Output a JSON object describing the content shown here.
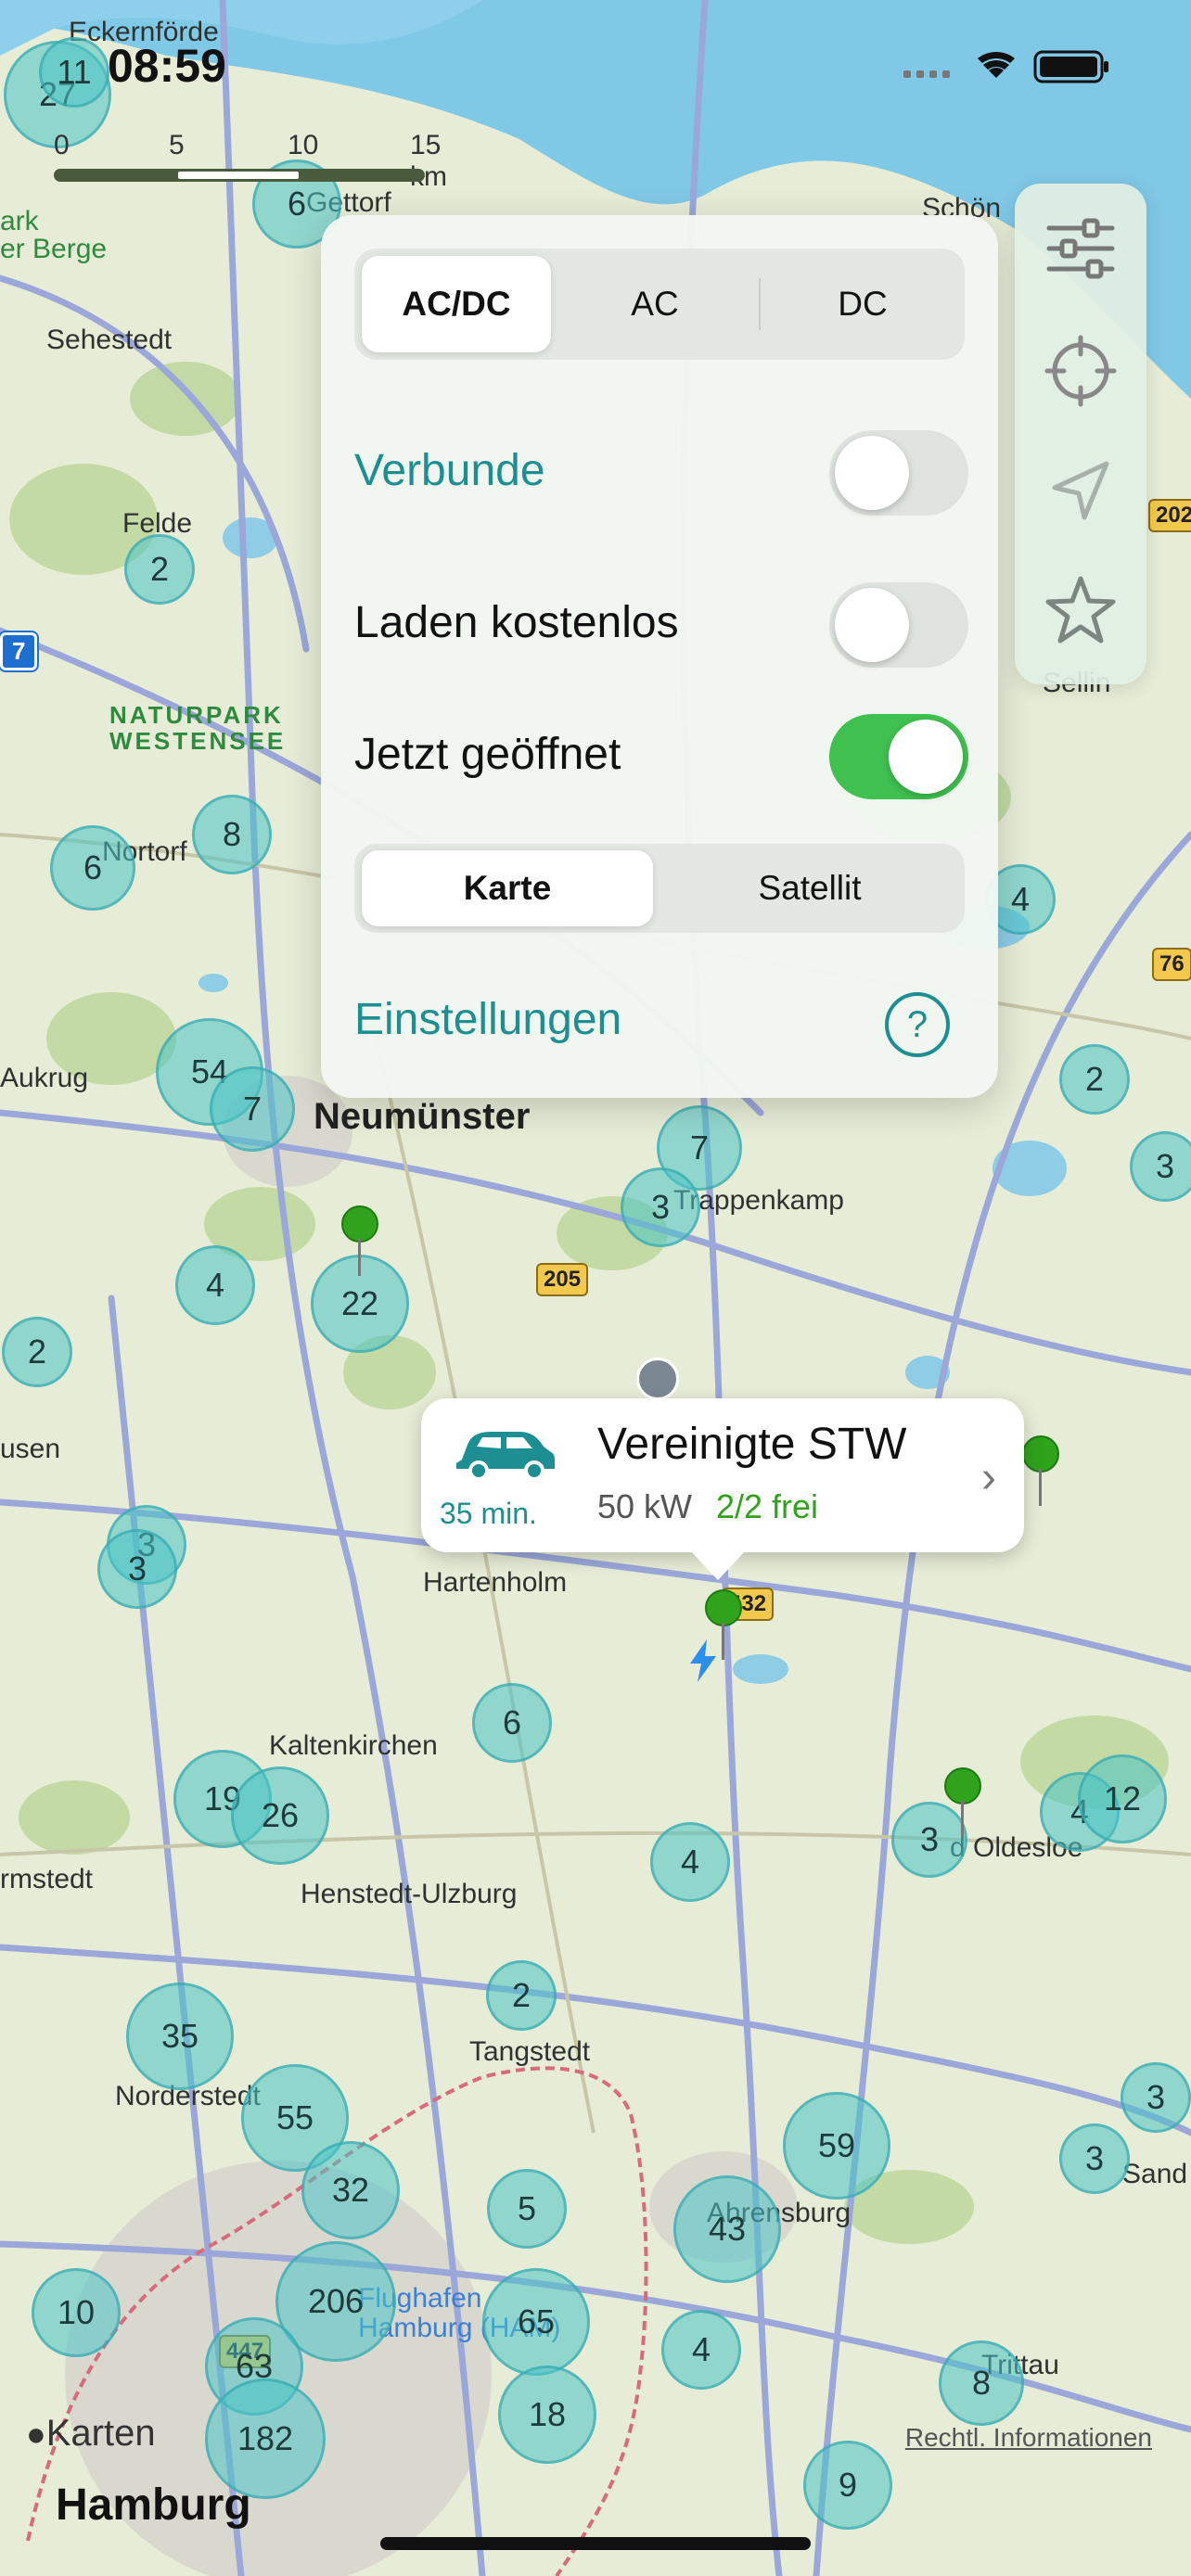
{
  "status": {
    "time": "08:59"
  },
  "scale": {
    "ticks": [
      "0",
      "5",
      "10",
      "15 km"
    ]
  },
  "panel": {
    "power_segment": {
      "options": [
        "AC/DC",
        "AC",
        "DC"
      ],
      "selected": "AC/DC"
    },
    "toggles": [
      {
        "label": "Verbunde",
        "on": false
      },
      {
        "label": "Laden kostenlos",
        "on": false
      },
      {
        "label": "Jetzt geöffnet",
        "on": true
      }
    ],
    "map_type": {
      "options": [
        "Karte",
        "Satellit"
      ],
      "selected": "Karte"
    },
    "settings_label": "Einstellungen",
    "help_icon": "?"
  },
  "toolbar": {
    "icons": [
      "filter-sliders-icon",
      "crosshair-icon",
      "location-arrow-icon",
      "star-icon"
    ]
  },
  "callout": {
    "title": "Vereinigte STW",
    "power": "50 kW",
    "availability": "2/2 frei",
    "eta": "35 min.",
    "icon": "car-icon"
  },
  "places": {
    "eckernfoerde": "Eckernförde",
    "gettorf": "Gettorf",
    "schoen": "Schön",
    "naturpark_ark": "ark",
    "huettener_berge": "er Berge",
    "sehestedt": "Sehestedt",
    "felde": "Felde",
    "naturpark": "NATURPARK",
    "westensee": "WESTENSEE",
    "nortorf": "Nortorf",
    "aukrug": "Aukrug",
    "neumuenster": "Neumünster",
    "trappenkamp": "Trappenkamp",
    "sellin": "Sellin",
    "hausen": "usen",
    "hartenholm": "Hartenholm",
    "kaltenkirchen": "Kaltenkirchen",
    "barmstedt": "rmstedt",
    "henstedt": "Henstedt-Ulzburg",
    "oldesloe": "d Oldesloe",
    "tangstedt": "Tangstedt",
    "norderstedt": "Norderstedt",
    "ahrensburg": "Ahrensburg",
    "flughafen1": "Flughafen",
    "flughafen2": "Hamburg (HAM)",
    "trittau": "Trittau",
    "sande": "Sand",
    "hamburg": "Hamburg"
  },
  "roads": {
    "r202": "202",
    "r7": "7",
    "r76": "76",
    "r205": "205",
    "r432": "432",
    "r447": "447"
  },
  "clusters": [
    {
      "n": "27"
    },
    {
      "n": "11"
    },
    {
      "n": "6"
    },
    {
      "n": "2"
    },
    {
      "n": "8"
    },
    {
      "n": "6"
    },
    {
      "n": "54"
    },
    {
      "n": "7"
    },
    {
      "n": "4"
    },
    {
      "n": "22"
    },
    {
      "n": "2"
    },
    {
      "n": "3"
    },
    {
      "n": "3"
    },
    {
      "n": "7"
    },
    {
      "n": "3"
    },
    {
      "n": "4"
    },
    {
      "n": "2"
    },
    {
      "n": "3"
    },
    {
      "n": "6"
    },
    {
      "n": "19"
    },
    {
      "n": "26"
    },
    {
      "n": "4"
    },
    {
      "n": "2"
    },
    {
      "n": "35"
    },
    {
      "n": "55"
    },
    {
      "n": "32"
    },
    {
      "n": "5"
    },
    {
      "n": "59"
    },
    {
      "n": "43"
    },
    {
      "n": "206"
    },
    {
      "n": "65"
    },
    {
      "n": "63"
    },
    {
      "n": "182"
    },
    {
      "n": "18"
    },
    {
      "n": "4"
    },
    {
      "n": "8"
    },
    {
      "n": "9"
    },
    {
      "n": "10"
    },
    {
      "n": "3"
    },
    {
      "n": "4"
    },
    {
      "n": "12"
    },
    {
      "n": "3"
    },
    {
      "n": "3"
    }
  ],
  "footer": {
    "maps_brand": "Karten",
    "legal": "Rechtl. Informationen"
  }
}
